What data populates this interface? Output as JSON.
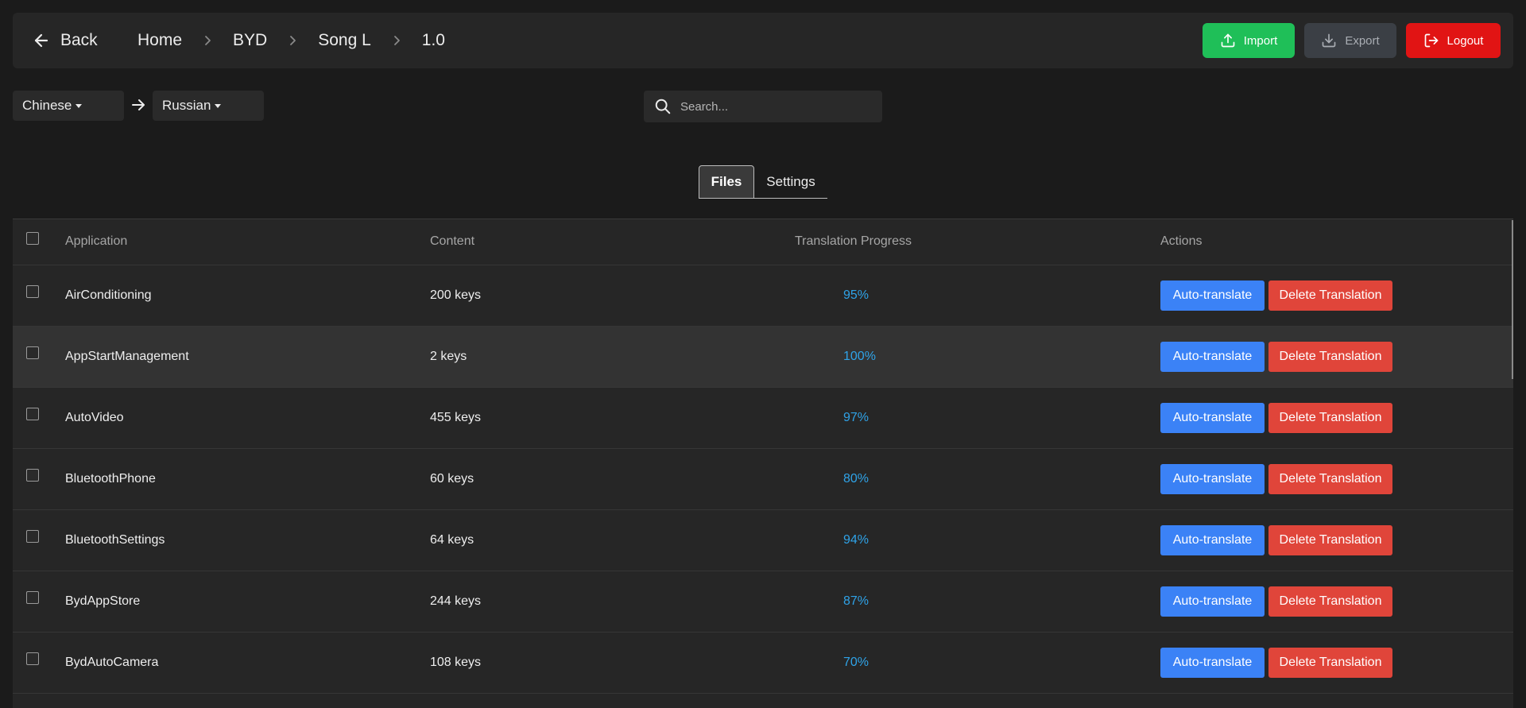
{
  "header": {
    "back_label": "Back",
    "breadcrumb": [
      "Home",
      "BYD",
      "Song L",
      "1.0"
    ],
    "import_label": "Import",
    "export_label": "Export",
    "logout_label": "Logout"
  },
  "languages": {
    "from": "Chinese",
    "to": "Russian"
  },
  "search": {
    "placeholder": "Search...",
    "value": ""
  },
  "tabs": [
    {
      "label": "Files",
      "active": true
    },
    {
      "label": "Settings",
      "active": false
    }
  ],
  "table": {
    "headers": {
      "application": "Application",
      "content": "Content",
      "progress": "Translation Progress",
      "actions": "Actions"
    },
    "action_labels": {
      "auto_translate": "Auto-translate",
      "delete_translation": "Delete Translation"
    },
    "rows": [
      {
        "application": "AirConditioning",
        "content": "200 keys",
        "progress": "95%"
      },
      {
        "application": "AppStartManagement",
        "content": "2 keys",
        "progress": "100%"
      },
      {
        "application": "AutoVideo",
        "content": "455 keys",
        "progress": "97%"
      },
      {
        "application": "BluetoothPhone",
        "content": "60 keys",
        "progress": "80%"
      },
      {
        "application": "BluetoothSettings",
        "content": "64 keys",
        "progress": "94%"
      },
      {
        "application": "BydAppStore",
        "content": "244 keys",
        "progress": "87%"
      },
      {
        "application": "BydAutoCamera",
        "content": "108 keys",
        "progress": "70%"
      }
    ]
  },
  "colors": {
    "import": "#1fbf58",
    "export": "#3b3f45",
    "logout": "#e11414",
    "auto_translate": "#3b82f6",
    "delete_translation": "#e0453a",
    "progress_text": "#2fa3e8"
  }
}
